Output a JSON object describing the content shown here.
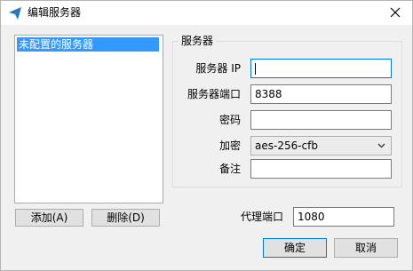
{
  "window": {
    "title": "编辑服务器"
  },
  "server_list": {
    "items": [
      {
        "label": "未配置的服务器",
        "selected": true
      }
    ]
  },
  "buttons": {
    "add": "添加(A)",
    "delete": "删除(D)",
    "ok": "确定",
    "cancel": "取消"
  },
  "group": {
    "title": "服务器",
    "fields": {
      "ip": {
        "label": "服务器 IP",
        "value": ""
      },
      "port": {
        "label": "服务器端口",
        "value": "8388"
      },
      "password": {
        "label": "密码",
        "value": ""
      },
      "encryption": {
        "label": "加密",
        "value": "aes-256-cfb"
      },
      "remark": {
        "label": "备注",
        "value": ""
      }
    }
  },
  "proxy": {
    "label": "代理端口",
    "value": "1080"
  },
  "icons": {
    "app": "paper-plane-icon",
    "close": "close-icon",
    "dropdown": "chevron-down-icon"
  },
  "colors": {
    "selection": "#3399ff",
    "accent": "#0078d7",
    "app_icon": "#1e73be"
  }
}
